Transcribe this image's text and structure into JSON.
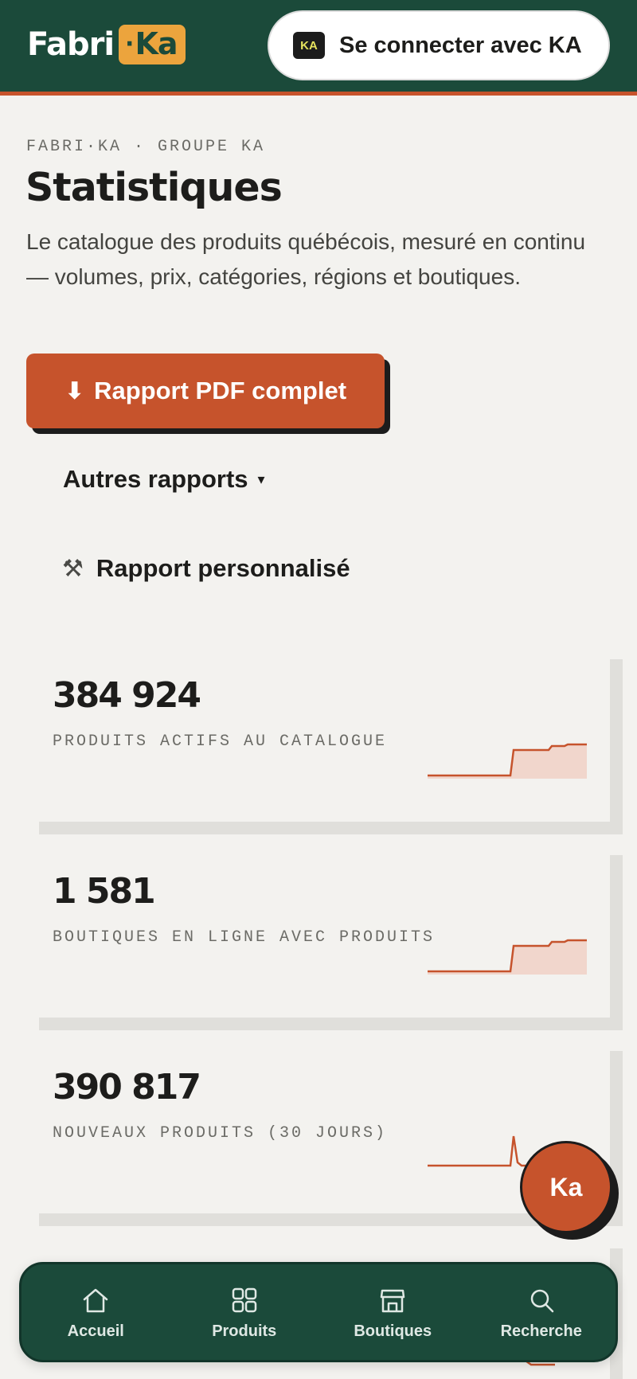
{
  "header": {
    "logo_text": "Fabri",
    "logo_badge_dot": "·",
    "logo_badge_text": "Ka",
    "connect_chip": "KA",
    "connect_label": "Se connecter avec KA"
  },
  "intro": {
    "eyebrow": "FABRI·KA · GROUPE KA",
    "title": "Statistiques",
    "lead": "Le catalogue des produits québécois, mesuré en continu — volumes, prix, catégories, régions et boutiques."
  },
  "actions": {
    "pdf_icon": "⬇",
    "pdf_label": "Rapport PDF complet",
    "other_reports_label": "Autres rapports",
    "other_reports_caret": "▾",
    "custom_icon": "⚒",
    "custom_label": "Rapport personnalisé"
  },
  "stats": [
    {
      "value": "384 924",
      "label": "PRODUITS ACTIFS AU CATALOGUE"
    },
    {
      "value": "1 581",
      "label": "BOUTIQUES EN LIGNE AVEC PRODUITS"
    },
    {
      "value": "390 817",
      "label": "NOUVEAUX PRODUITS (30 JOURS)"
    }
  ],
  "fab_label": "Ka",
  "nav": {
    "items": [
      {
        "label": "Accueil",
        "icon": "home-icon"
      },
      {
        "label": "Produits",
        "icon": "grid-icon"
      },
      {
        "label": "Boutiques",
        "icon": "store-icon"
      },
      {
        "label": "Recherche",
        "icon": "search-icon"
      }
    ]
  },
  "colors": {
    "header_bg": "#1b4a3a",
    "accent": "#c6532c",
    "logo_badge": "#eca43d",
    "page_bg": "#f3f2ef"
  }
}
